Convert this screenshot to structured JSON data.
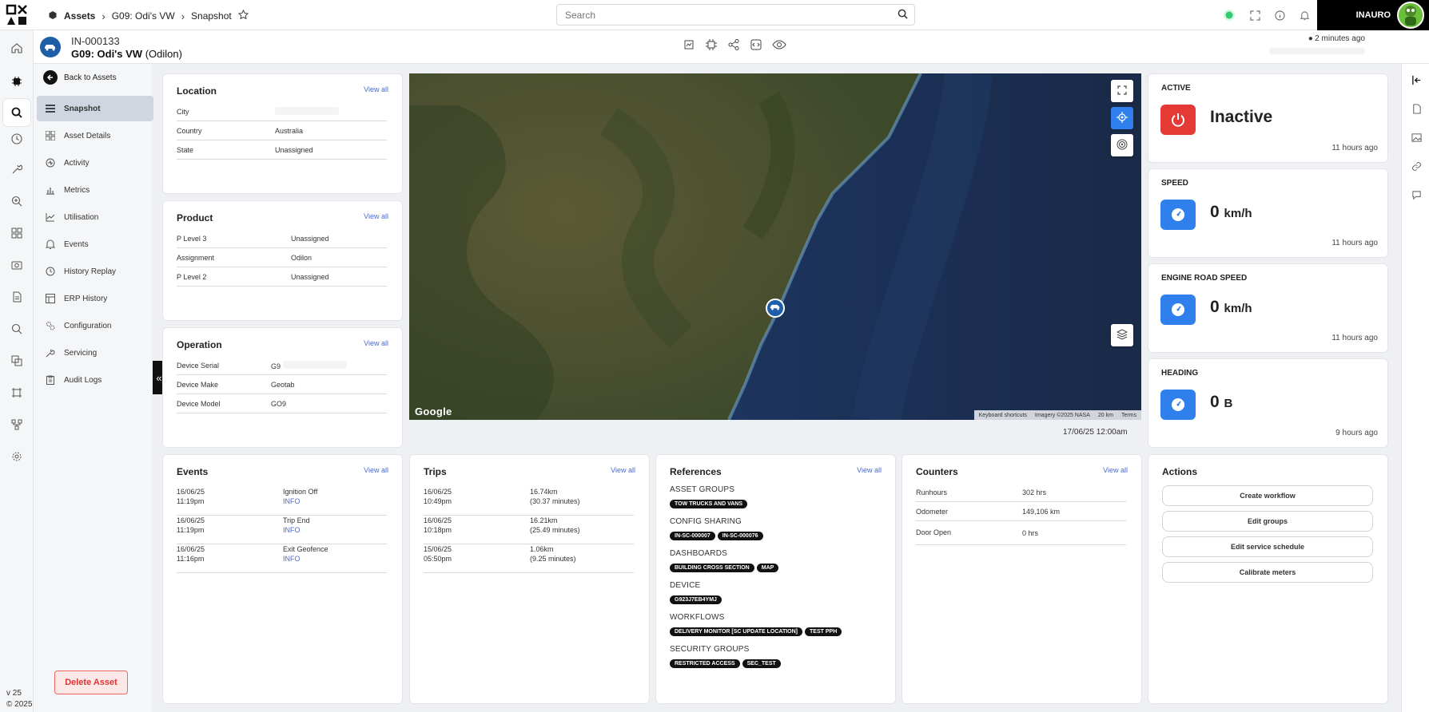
{
  "topbar": {
    "breadcrumbs": [
      "Assets",
      "G09: Odi's VW",
      "Snapshot"
    ],
    "search_placeholder": "Search",
    "user_name": "INAURO",
    "status_color": "#2ecc71"
  },
  "asset": {
    "id": "IN-000133",
    "name": "G09: Odi's VW",
    "owner": "(Odilon)",
    "last_seen": "2 minutes ago"
  },
  "nav": {
    "back_label": "Back to Assets",
    "items": [
      {
        "label": "Snapshot",
        "icon": "menu-icon"
      },
      {
        "label": "Asset Details",
        "icon": "grid-icon"
      },
      {
        "label": "Activity",
        "icon": "activity-icon"
      },
      {
        "label": "Metrics",
        "icon": "bar-chart-icon"
      },
      {
        "label": "Utilisation",
        "icon": "line-chart-icon"
      },
      {
        "label": "Events",
        "icon": "bell-icon"
      },
      {
        "label": "History Replay",
        "icon": "clock-icon"
      },
      {
        "label": "ERP History",
        "icon": "table-icon"
      },
      {
        "label": "Configuration",
        "icon": "cogs-icon"
      },
      {
        "label": "Servicing",
        "icon": "wrench-icon"
      },
      {
        "label": "Audit Logs",
        "icon": "clipboard-icon"
      }
    ],
    "delete_label": "Delete Asset",
    "version": "v 25",
    "copyright": "© 2025"
  },
  "location": {
    "title": "Location",
    "view_all": "View all",
    "rows": [
      {
        "k": "City",
        "v": ""
      },
      {
        "k": "Country",
        "v": "Australia"
      },
      {
        "k": "State",
        "v": "Unassigned"
      }
    ]
  },
  "product": {
    "title": "Product",
    "view_all": "View all",
    "rows": [
      {
        "k": "P Level 3",
        "v": "Unassigned"
      },
      {
        "k": "Assignment",
        "v": "Odilon"
      },
      {
        "k": "P Level 2",
        "v": "Unassigned"
      }
    ]
  },
  "operation": {
    "title": "Operation",
    "view_all": "View all",
    "rows": [
      {
        "k": "Device Serial",
        "v": "G9"
      },
      {
        "k": "Device Make",
        "v": "Geotab"
      },
      {
        "k": "Device Model",
        "v": "GO9"
      }
    ]
  },
  "map": {
    "google": "Google",
    "attribution": [
      "Keyboard shortcuts",
      "Imagery ©2025 NASA",
      "20 km",
      "Terms"
    ],
    "date": "17/06/25 12:00am"
  },
  "status": {
    "active": {
      "title": "ACTIVE",
      "value": "Inactive",
      "time": "11 hours ago",
      "color": "#e53935"
    },
    "speed": {
      "title": "SPEED",
      "value": "0",
      "unit": "km/h",
      "time": "11 hours ago",
      "color": "#2f80ed"
    },
    "engine": {
      "title": "ENGINE ROAD SPEED",
      "value": "0",
      "unit": "km/h",
      "time": "11 hours ago",
      "color": "#2f80ed"
    },
    "heading": {
      "title": "HEADING",
      "value": "0",
      "unit": "B",
      "time": "9 hours ago",
      "color": "#2f80ed"
    }
  },
  "events": {
    "title": "Events",
    "view_all": "View all",
    "rows": [
      {
        "date": "16/06/25",
        "time": "11:19pm",
        "name": "Ignition Off",
        "info": "INFO"
      },
      {
        "date": "16/06/25",
        "time": "11:19pm",
        "name": "Trip End",
        "info": "INFO"
      },
      {
        "date": "16/06/25",
        "time": "11:16pm",
        "name": "Exit Geofence",
        "info": "INFO"
      }
    ]
  },
  "trips": {
    "title": "Trips",
    "view_all": "View all",
    "rows": [
      {
        "date": "16/06/25",
        "time": "10:49pm",
        "dist": "16.74km",
        "dur": "(30.37 minutes)"
      },
      {
        "date": "16/06/25",
        "time": "10:18pm",
        "dist": "16.21km",
        "dur": "(25.49 minutes)"
      },
      {
        "date": "15/06/25",
        "time": "05:50pm",
        "dist": "1.06km",
        "dur": "(9.25 minutes)"
      }
    ]
  },
  "references": {
    "title": "References",
    "view_all": "View all",
    "groups": [
      {
        "name": "ASSET GROUPS",
        "chips": [
          "TOW TRUCKS AND VANS"
        ]
      },
      {
        "name": "CONFIG SHARING",
        "chips": [
          "IN-SC-000007",
          "IN-SC-000076"
        ]
      },
      {
        "name": "DASHBOARDS",
        "chips": [
          "BUILDING CROSS SECTION",
          "MAP"
        ]
      },
      {
        "name": "DEVICE",
        "chips": [
          "G923J7EB4YMJ"
        ]
      },
      {
        "name": "WORKFLOWS",
        "chips": [
          "DELIVERY MONITOR [SC UPDATE LOCATION]",
          "TEST PPH"
        ]
      },
      {
        "name": "SECURITY GROUPS",
        "chips": [
          "RESTRICTED ACCESS",
          "SEC_TEST"
        ]
      }
    ]
  },
  "counters": {
    "title": "Counters",
    "view_all": "View all",
    "rows": [
      {
        "k": "Runhours",
        "v": "302 hrs"
      },
      {
        "k": "Odometer",
        "v": "149,106 km"
      },
      {
        "k": "Door Open",
        "v": "0 hrs"
      }
    ]
  },
  "actions": {
    "title": "Actions",
    "buttons": [
      "Create workflow",
      "Edit groups",
      "Edit service schedule",
      "Calibrate meters"
    ]
  }
}
